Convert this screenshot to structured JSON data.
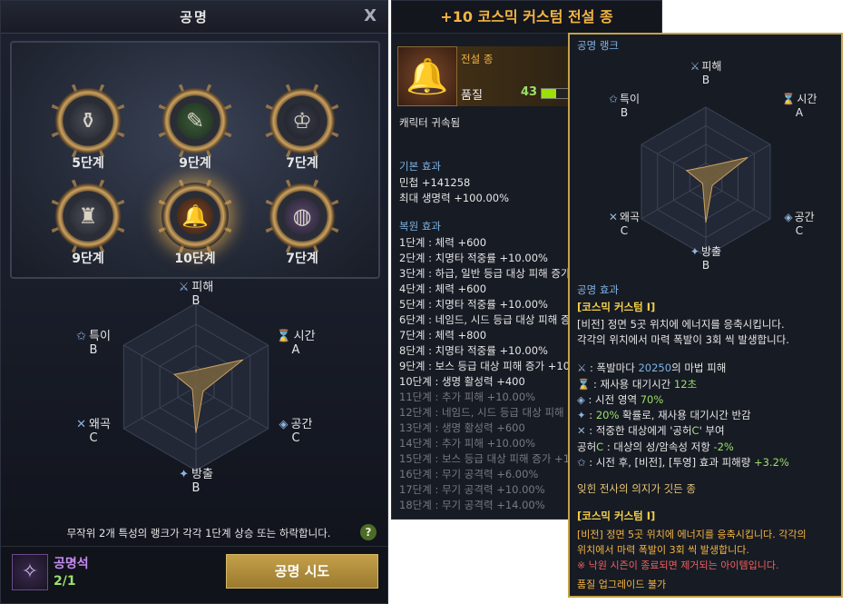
{
  "left": {
    "title": "공명",
    "close": "X",
    "medals": [
      {
        "label": "5단계",
        "icon": "⚱"
      },
      {
        "label": "9단계",
        "icon": "✎"
      },
      {
        "label": "7단계",
        "icon": "♔"
      },
      {
        "label": "9단계",
        "icon": "♜"
      },
      {
        "label": "10단계",
        "icon": "🔔"
      },
      {
        "label": "7단계",
        "icon": "◍"
      }
    ],
    "radar": {
      "axes": [
        {
          "name": "피해",
          "rank": "B",
          "icon": "⚔"
        },
        {
          "name": "시간",
          "rank": "A",
          "icon": "⌛"
        },
        {
          "name": "공간",
          "rank": "C",
          "icon": "◈"
        },
        {
          "name": "방출",
          "rank": "B",
          "icon": "✦"
        },
        {
          "name": "왜곡",
          "rank": "C",
          "icon": "✕"
        },
        {
          "name": "특이",
          "rank": "B",
          "icon": "✩"
        }
      ],
      "levels": {
        "피해": 0.2,
        "시간": 0.65,
        "공간": 0.1,
        "방출": 0.55,
        "왜곡": 0.05,
        "특이": 0.3
      }
    },
    "notice": "무작위 2개 특성의 랭크가 각각 1단계 상승 또는 하락합니다.",
    "help": "?",
    "gem_name": "공명석",
    "gem_count": "2/1",
    "attempt_button": "공명 시도"
  },
  "mid": {
    "title": "+10 코스믹 커스텀 전설 종",
    "grade": "전설 종",
    "quality_label": "품질",
    "quality_value": "43",
    "quality_fill": 0.43,
    "bound": "캐릭터 귀속됨",
    "base_title": "기본 효과",
    "base_lines": [
      "민첩 +141258",
      "최대 생명력 +100.00%"
    ],
    "restore_title": "복원 효과",
    "restore_lines": [
      "1단계 : 체력 +600",
      "2단계 : 치명타 적중률 +10.00%",
      "3단계 : 하급, 일반 등급 대상 피해 증가",
      "4단계 : 체력 +600",
      "5단계 : 치명타 적중률 +10.00%",
      "6단계 : 네임드, 시드 등급 대상 피해 증",
      "7단계 : 체력 +800",
      "8단계 : 치명타 적중률 +10.00%",
      "9단계 : 보스 등급 대상 피해 증가 +10",
      "10단계 : 생명 활성력 +400"
    ],
    "restore_dim": [
      "11단계 : 추가 피해 +10.00%",
      "12단계 : 네임드, 시드 등급 대상 피해",
      "13단계 : 생명 활성력 +600",
      "14단계 : 추가 피해 +10.00%",
      "15단계 : 보스 등급 대상 피해 증가 +1",
      "16단계 : 무기 공격력 +6.00%",
      "17단계 : 무기 공격력 +10.00%",
      "18단계 : 무기 공격력 +14.00%"
    ]
  },
  "right": {
    "rank_title": "공명 랭크",
    "axes": [
      {
        "name": "피해",
        "rank": "B",
        "icon": "⚔"
      },
      {
        "name": "시간",
        "rank": "A",
        "icon": "⌛"
      },
      {
        "name": "공간",
        "rank": "C",
        "icon": "◈"
      },
      {
        "name": "방출",
        "rank": "B",
        "icon": "✦"
      },
      {
        "name": "왜곡",
        "rank": "C",
        "icon": "✕"
      },
      {
        "name": "특이",
        "rank": "B",
        "icon": "✩"
      }
    ],
    "levels": {
      "피해": 0.2,
      "시간": 0.65,
      "공간": 0.1,
      "방출": 0.55,
      "왜곡": 0.05,
      "특이": 0.3
    },
    "effect_title": "공명 효과",
    "effect_name": "[코스믹 커스텀 I]",
    "desc1": "[비전] 정면 5곳 위치에 에너지를 응축시킵니다.",
    "desc2": "각각의 위치에서 마력 폭발이 3회 씩 발생합니다.",
    "s1a": ": 폭발마다 ",
    "s1b": "20250",
    "s1c": "의 마법 피해",
    "s2a": ": 재사용 대기시간 ",
    "s2b": "12초",
    "s3a": ": 시전 영역 ",
    "s3b": "70%",
    "s4a": ": ",
    "s4b": "20%",
    "s4c": " 확률로, 재사용 대기시간 반감",
    "s5a": ": 적중한 대상에게 '공허",
    "s5b": "C",
    "s5c": "' 부여",
    "s6a": "공허",
    "s6b": "C",
    "s6c": " : 대상의 성/암속성 저항 ",
    "s6d": "-2%",
    "s7a": ": 시전 후, [비전], [투영] 효과 피해량 ",
    "s7b": "+3.2%",
    "flavor": "잊힌 전사의 의지가 깃든 종",
    "effect_name2": "[코스믹 커스텀 I]",
    "desc3": "[비전] 정면 5곳 위치에 에너지를 응축시킵니다. 각각의",
    "desc4": "위치에서 마력 폭발이 3회 씩 발생합니다.",
    "warn": "※ 낙원 시즌이 종료되면 제거되는 아이템입니다.",
    "no_upgrade": "품질 업그레이드 불가"
  }
}
